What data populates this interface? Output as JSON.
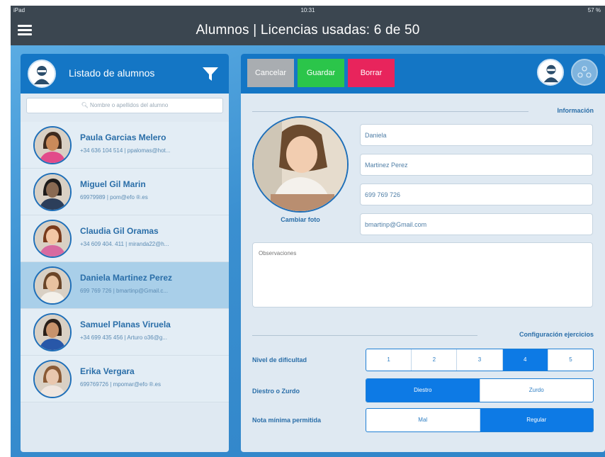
{
  "status_bar": {
    "left": "iPad",
    "time": "10:31",
    "battery": "57 %"
  },
  "header": {
    "title": "Alumnos | Licencias usadas: 6 de 50"
  },
  "sidebar": {
    "title": "Listado de alumnos",
    "search_placeholder": "Nombre o apellidos del alumno",
    "students": [
      {
        "name": "Paula Garcias Melero",
        "info": "+34 636 104 514 | ppalomas@hot...",
        "selected": false
      },
      {
        "name": "Miguel Gil Marin",
        "info": "69979989 | pom@efo ®.es",
        "selected": false
      },
      {
        "name": "Claudia Gil Oramas",
        "info": "+34 609 404. 411 | miranda22@h...",
        "selected": false
      },
      {
        "name": "Daniela Martinez Perez",
        "info": "699 769 726 | bmartinp@Gmail.c...",
        "selected": true
      },
      {
        "name": "Samuel Planas Viruela",
        "info": "+34 699 435 456 | Arturo o36@g...",
        "selected": false
      },
      {
        "name": "Erika Vergara",
        "info": "699769726 | mpomar@efo ®.es",
        "selected": false
      }
    ]
  },
  "toolbar": {
    "cancel": "Cancelar",
    "save": "Guardar",
    "delete": "Borrar"
  },
  "form": {
    "section_info": "Información",
    "change_photo": "Cambiar foto",
    "first_name": "Daniela",
    "last_name": "Martinez Perez",
    "phone": "699 769 726",
    "email": "bmartinp@Gmail.com",
    "notes_placeholder": "Observaciones"
  },
  "exercise_config": {
    "section_title": "Configuración ejercicios",
    "difficulty_label": "Nivel de dificultad",
    "difficulty_options": [
      "1",
      "2",
      "3",
      "4",
      "5"
    ],
    "difficulty_selected": "4",
    "hand_label": "Diestro o Zurdo",
    "hand_options": [
      "Diestro",
      "Zurdo"
    ],
    "hand_selected": "Diestro",
    "min_grade_label": "Nota mínima permitida",
    "min_grade_options": [
      "Mal",
      "Regular"
    ],
    "min_grade_selected": "Regular"
  },
  "colors": {
    "header_bg": "#3b4650",
    "panel_header": "#1476c5",
    "cancel": "#a9adb1",
    "save": "#2bc54a",
    "delete": "#e8245c",
    "segment_active": "#0d7ae5"
  },
  "icons": [
    "menu-icon",
    "student-avatar-icon",
    "filter-icon",
    "users-group-icon"
  ]
}
